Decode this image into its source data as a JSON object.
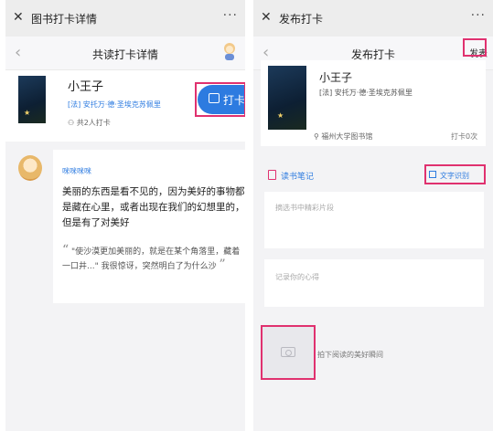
{
  "left": {
    "titlebar": {
      "close": "✕",
      "title": "图书打卡详情",
      "more": "···"
    },
    "navbar": {
      "back": "‹",
      "title": "共读打卡详情"
    },
    "book": {
      "title": "小王子",
      "author": "[法] 安托万·德·圣埃克苏佩里",
      "participants": "共2人打卡"
    },
    "checkin_button": "打卡",
    "post": {
      "username": "咪咪咪咪",
      "content": "美丽的东西是看不见的，因为美好的事物都是藏在心里，或者出现在我们的幻想里的，但是有了对美好",
      "quote_open": "“",
      "quote": "\"使沙漠更加美丽的，就是在某个角落里，藏着一口井...\" 我很惊讶，突然明白了为什么沙",
      "quote_close": "”"
    }
  },
  "right": {
    "titlebar": {
      "close": "✕",
      "title": "发布打卡",
      "more": "···"
    },
    "navbar": {
      "back": "‹",
      "title": "发布打卡",
      "publish": "发表"
    },
    "book": {
      "title": "小王子",
      "author": "[法] 安托万·德·圣埃克苏佩里",
      "library": "福州大学图书馆",
      "checkin_count": "打卡0次"
    },
    "notes_label": "读书笔记",
    "ocr_label": "文字识别",
    "excerpt_placeholder": "摘选书中精彩片段",
    "thoughts_placeholder": "记录你的心得",
    "photo_hint": "拍下阅读的美好瞬间"
  },
  "colors": {
    "accent": "#2d7be0",
    "highlight": "#e0316f"
  }
}
